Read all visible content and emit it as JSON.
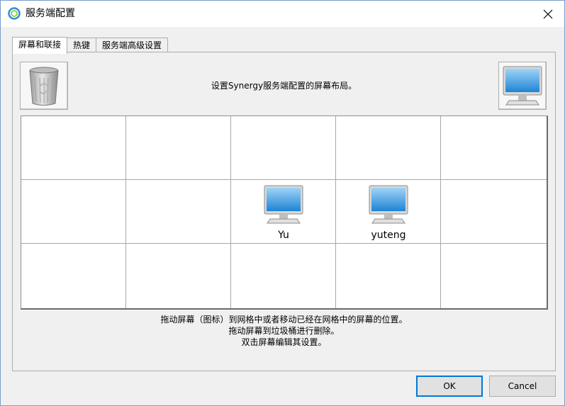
{
  "window": {
    "title": "服务端配置"
  },
  "tabs": [
    {
      "label": "屏幕和联接",
      "active": true
    },
    {
      "label": "热键",
      "active": false
    },
    {
      "label": "服务端高级设置",
      "active": false
    }
  ],
  "layout_panel": {
    "description": "设置Synergy服务端配置的屏幕布局。",
    "trash_icon": "trash-can-icon",
    "new_screen_icon": "monitor-icon",
    "grid": {
      "rows": 3,
      "cols": 5,
      "screens": [
        {
          "name": "Yu",
          "row": 1,
          "col": 2
        },
        {
          "name": "yuteng",
          "row": 1,
          "col": 3
        }
      ]
    },
    "hints": [
      "拖动屏幕（图标）到网格中或者移动已经在网格中的屏幕的位置。",
      "拖动屏幕到垃圾桶进行删除。",
      "双击屏幕编辑其设置。"
    ]
  },
  "buttons": {
    "ok": "OK",
    "cancel": "Cancel"
  },
  "colors": {
    "accent": "#0078d7",
    "monitor_screen": "#3a9ee0"
  }
}
